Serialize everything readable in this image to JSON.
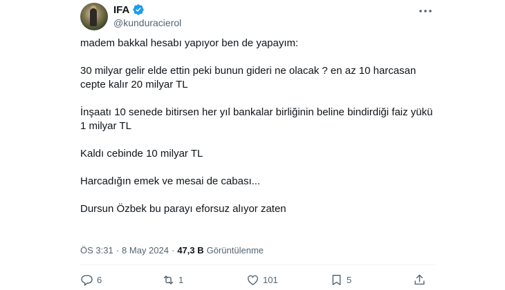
{
  "tweet": {
    "display_name": "IFA",
    "handle": "@kunduracierol",
    "paragraphs": [
      "madem bakkal hesabı yapıyor ben de yapayım:",
      "30 milyar gelir elde ettin peki bunun gideri ne olacak ? en az 10 harcasan cepte kalır 20 milyar TL",
      "İnşaatı 10 senede bitirsen her yıl bankalar birliğinin beline bindirdiği faiz yükü 1 milyar TL",
      "Kaldı cebinde 10 milyar TL",
      "Harcadığın emek ve mesai de cabası...",
      "Dursun Özbek bu parayı eforsuz alıyor zaten"
    ],
    "time": "ÖS 3:31",
    "separator": "·",
    "date": "8 May 2024",
    "views_count": "47,3 B",
    "views_label": "Görüntülenme"
  },
  "actions": {
    "replies": "6",
    "reposts": "1",
    "likes": "101",
    "bookmarks": "5"
  },
  "colors": {
    "verified": "#1d9bf0",
    "secondary_text": "#536471",
    "primary_text": "#0f1419"
  },
  "icons": [
    "verified-badge-icon",
    "more-icon",
    "reply-icon",
    "repost-icon",
    "like-icon",
    "bookmark-icon",
    "share-icon"
  ]
}
